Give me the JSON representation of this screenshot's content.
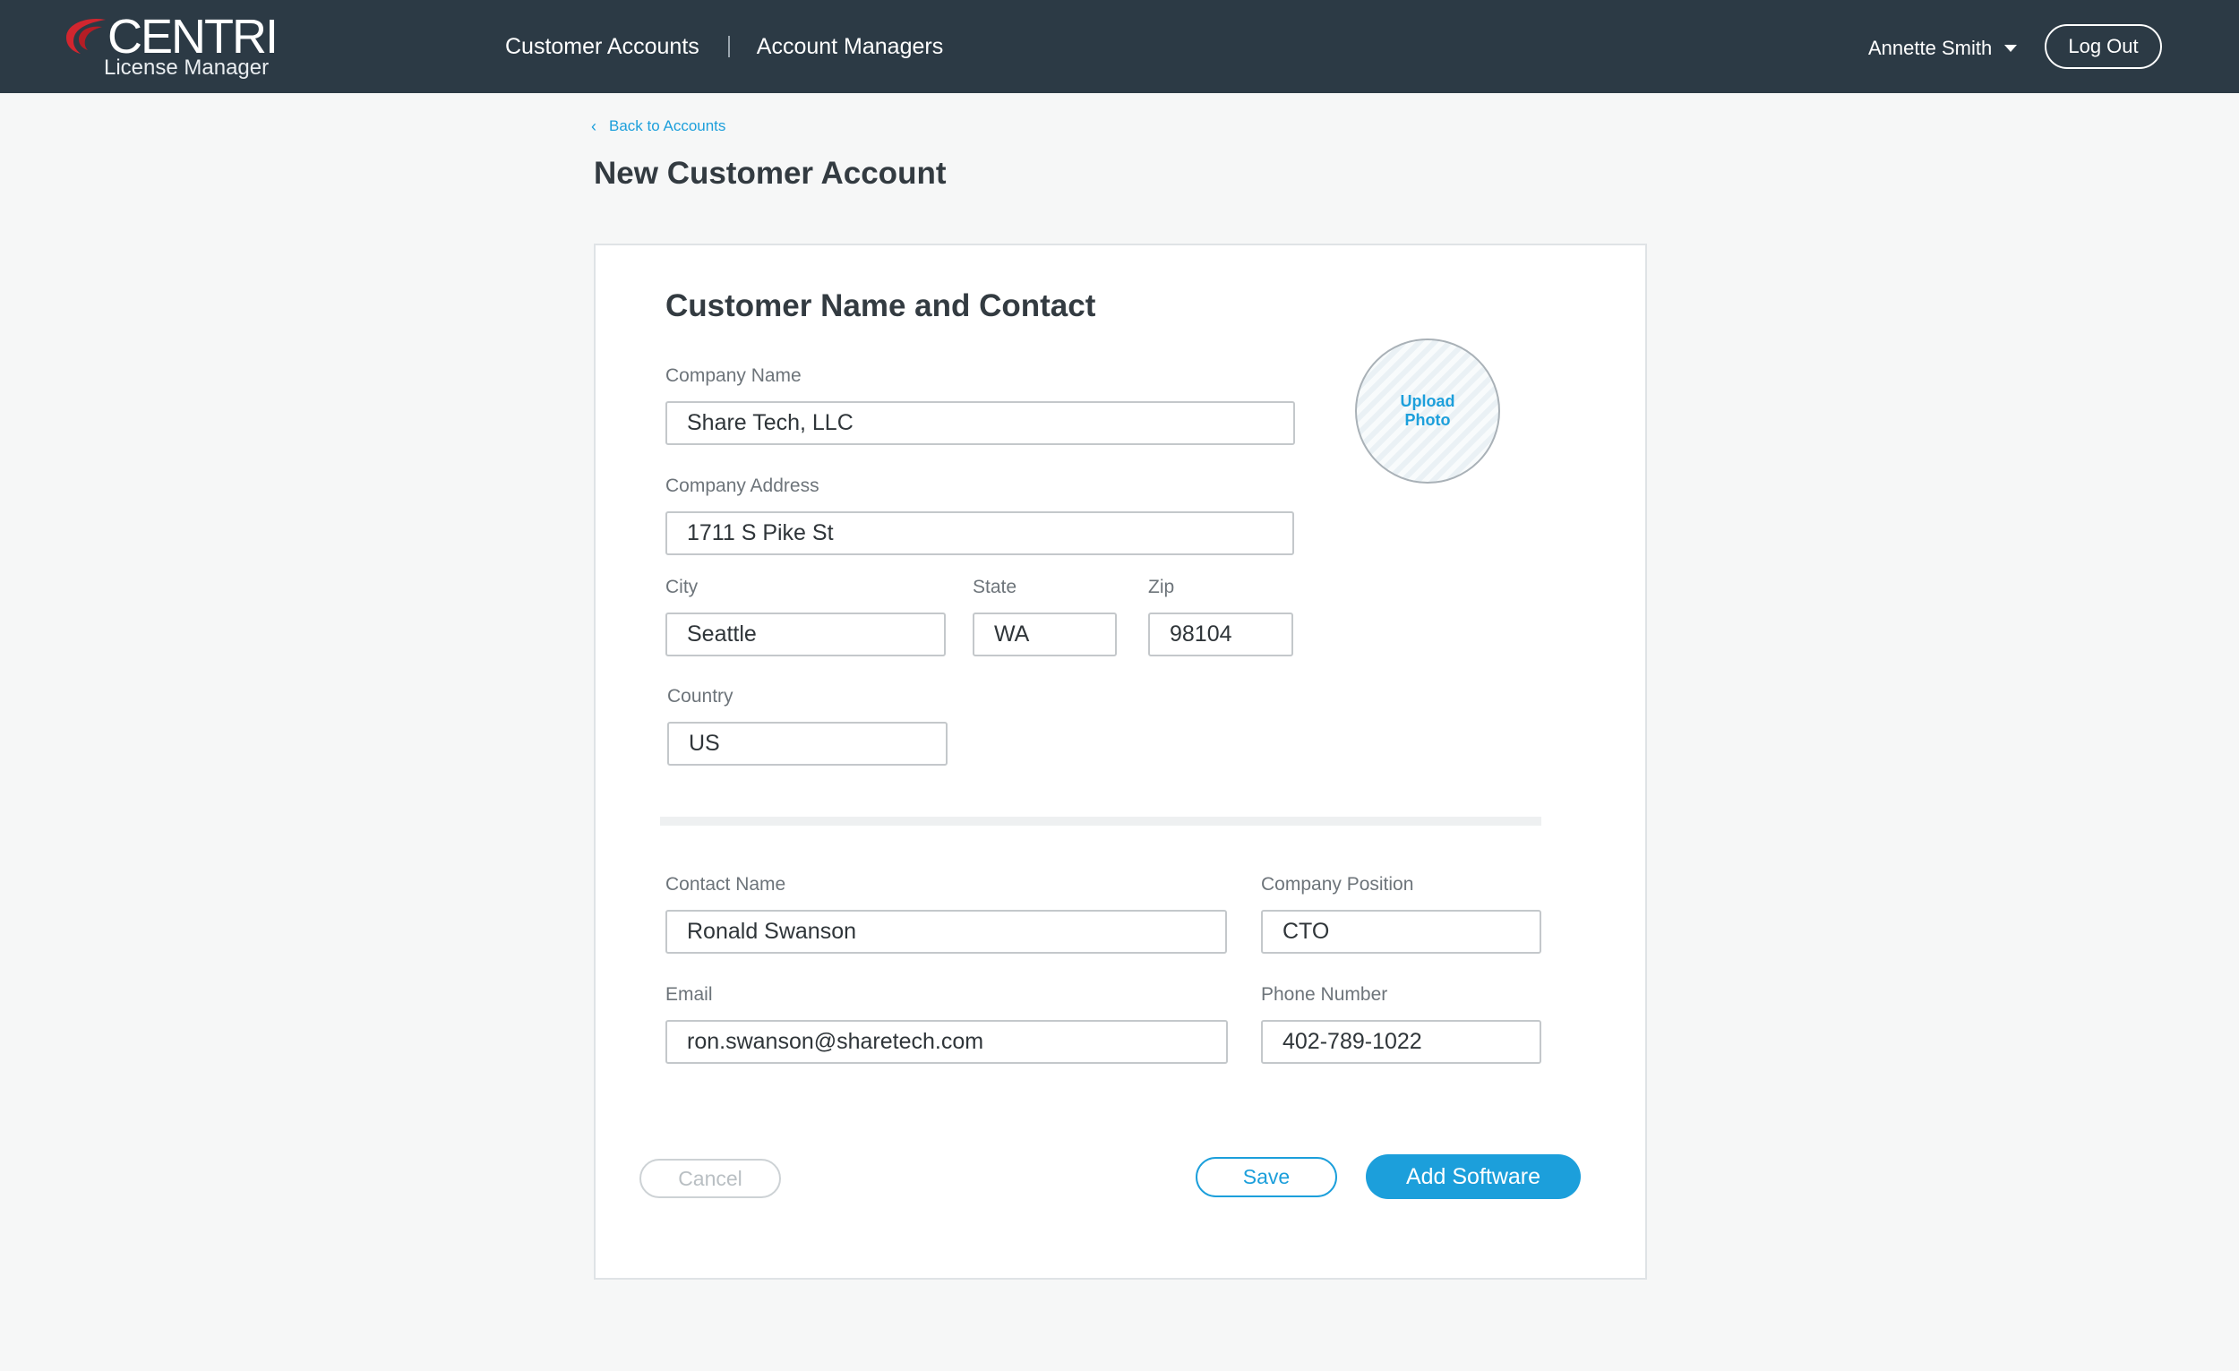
{
  "app": {
    "brand": "CENTRI",
    "product": "License Manager",
    "accent_color": "#1c9fdb",
    "logo_accent_color": "#d1262f",
    "topbar_color": "#2c3a45"
  },
  "nav": {
    "links": [
      "Customer Accounts",
      "Account Managers"
    ],
    "user_name": "Annette Smith",
    "logout_label": "Log Out",
    "user_menu_icon": "caret-down-icon"
  },
  "breadcrumb": {
    "back_label": "Back to Accounts",
    "back_icon": "chevron-left-icon"
  },
  "page": {
    "title": "New Customer Account"
  },
  "form": {
    "section_title": "Customer Name and Contact",
    "upload_photo_label": "Upload Photo",
    "company_name": {
      "label": "Company Name",
      "value": "Share Tech, LLC"
    },
    "company_address": {
      "label": "Company Address",
      "value": "1711 S Pike St"
    },
    "city": {
      "label": "City",
      "value": "Seattle"
    },
    "state": {
      "label": "State",
      "value": "WA"
    },
    "zip": {
      "label": "Zip",
      "value": "98104"
    },
    "country": {
      "label": "Country",
      "value": "US"
    },
    "contact_name": {
      "label": "Contact Name",
      "value": "Ronald Swanson"
    },
    "company_position": {
      "label": "Company Position",
      "value": "CTO"
    },
    "email": {
      "label": "Email",
      "value": "ron.swanson@sharetech.com"
    },
    "phone": {
      "label": "Phone Number",
      "value": "402-789-1022"
    }
  },
  "actions": {
    "cancel_label": "Cancel",
    "save_label": "Save",
    "add_software_label": "Add Software"
  }
}
